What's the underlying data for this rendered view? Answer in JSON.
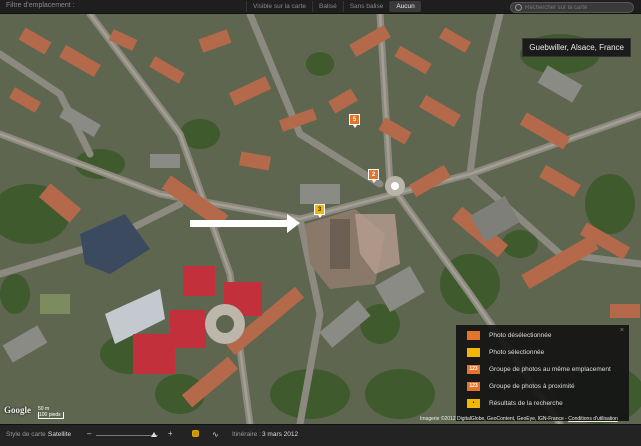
{
  "topbar": {
    "filter_label": "Filtre d'emplacement :",
    "segments": [
      "Visible sur la carte",
      "Balisé",
      "Sans balise",
      "Aucun"
    ],
    "active_segment": "Aucun",
    "search_placeholder": "Rechercher sur la carte"
  },
  "map": {
    "location": "Guebwiller, Alsace, France",
    "markers": [
      {
        "label": "5",
        "state": "deselected"
      },
      {
        "label": "2",
        "state": "deselected"
      },
      {
        "label": "3",
        "state": "selected"
      }
    ],
    "scale_top": "50 m",
    "scale_bottom": "100 pieds",
    "google_logo": "Google",
    "copyright": "Imagerie ©2012 DigitalGlobe, GeoContent, GeoEye, IGN-France - ",
    "terms_link": "Conditions d'utilisation"
  },
  "legend": {
    "items": [
      {
        "icon": "orange-pin-icon",
        "label": "Photo désélectionnée",
        "color": "#e4742b",
        "badge": ""
      },
      {
        "icon": "yellow-pin-icon",
        "label": "Photo sélectionnée",
        "color": "#f2b705",
        "badge": ""
      },
      {
        "icon": "group-same-location-icon",
        "label": "Groupe de photos au même emplacement",
        "color": "#e4742b",
        "badge": "123"
      },
      {
        "icon": "group-nearby-icon",
        "label": "Groupe de photos à proximité",
        "color": "#e4742b",
        "badge": "123"
      },
      {
        "icon": "search-result-icon",
        "label": "Résultats de la recherche",
        "color": "#f2b705",
        "badge": ""
      }
    ]
  },
  "bottombar": {
    "style_label": "Style de carte :",
    "style_value": "Satellite",
    "zoom_level": 0.94,
    "track_label": "Itinéraire :",
    "track_value": "3 mars 2012"
  },
  "colors": {
    "deselected": "#e4742b",
    "selected": "#f2b705"
  }
}
